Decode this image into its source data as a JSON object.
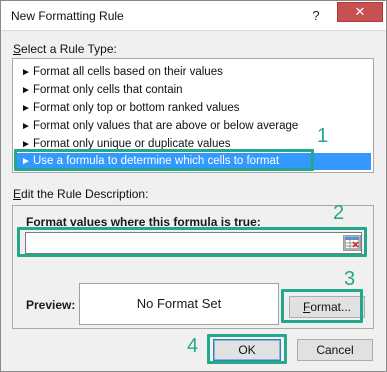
{
  "window": {
    "title": "New Formatting Rule",
    "help_glyph": "?",
    "close_glyph": "✕"
  },
  "rule_type": {
    "label_prefix": "S",
    "label_rest": "elect a Rule Type:",
    "arrow_glyph": "►",
    "items": [
      "Format all cells based on their values",
      "Format only cells that contain",
      "Format only top or bottom ranked values",
      "Format only values that are above or below average",
      "Format only unique or duplicate values",
      "Use a formula to determine which cells to format"
    ],
    "selected_index": 5
  },
  "description": {
    "label_prefix": "E",
    "label_rest": "dit the Rule Description:",
    "formula_label_prefix": "F",
    "formula_label_rest": "ormat values where this formula is true:",
    "formula_value": "",
    "preview_label": "Preview:",
    "preview_text": "No Format Set",
    "format_button_prefix": "F",
    "format_button_rest": "ormat..."
  },
  "buttons": {
    "ok": "OK",
    "cancel": "Cancel"
  },
  "callouts": {
    "one": "1",
    "two": "2",
    "three": "3",
    "four": "4",
    "color": "#25a78b"
  },
  "colors": {
    "selection": "#3399ff",
    "close_button": "#c75050"
  }
}
